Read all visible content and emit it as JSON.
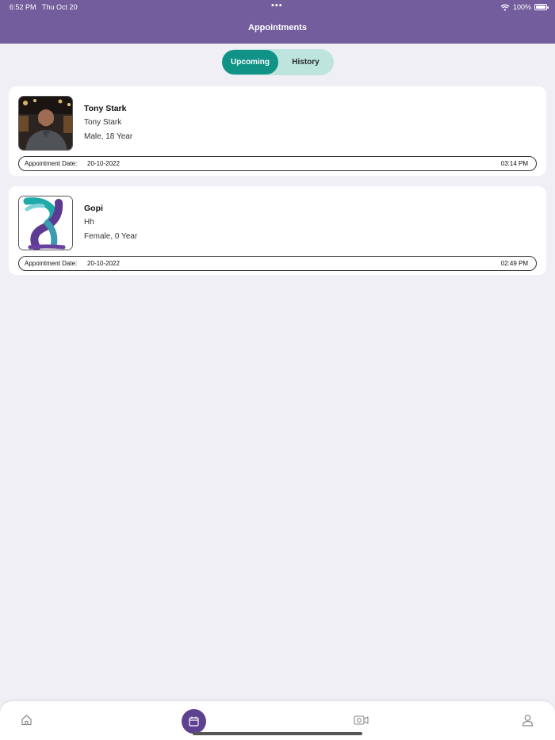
{
  "status_bar": {
    "time": "6:52 PM",
    "date": "Thu Oct 20",
    "battery": "100%"
  },
  "header": {
    "title": "Appointments"
  },
  "tabs": {
    "upcoming": "Upcoming",
    "history": "History",
    "active": "upcoming"
  },
  "appointments": [
    {
      "name": "Tony Stark",
      "subtitle": "Tony Stark",
      "details": "Male, 18 Year",
      "date_label": "Appointment Date:",
      "date": "20-10-2022",
      "time": "03:14 PM"
    },
    {
      "name": "Gopi",
      "subtitle": "Hh",
      "details": "Female, 0 Year",
      "date_label": "Appointment Date:",
      "date": "20-10-2022",
      "time": "02:49 PM"
    }
  ],
  "bottom_nav": {
    "items": [
      "home-icon",
      "calendar-icon",
      "video-camera-icon",
      "user-icon"
    ],
    "active": "calendar-icon"
  },
  "colors": {
    "header": "#735d9d",
    "accent": "#119286",
    "segment_bg": "#bde5de",
    "nav_active": "#5f4192",
    "background": "#f1eff6"
  }
}
